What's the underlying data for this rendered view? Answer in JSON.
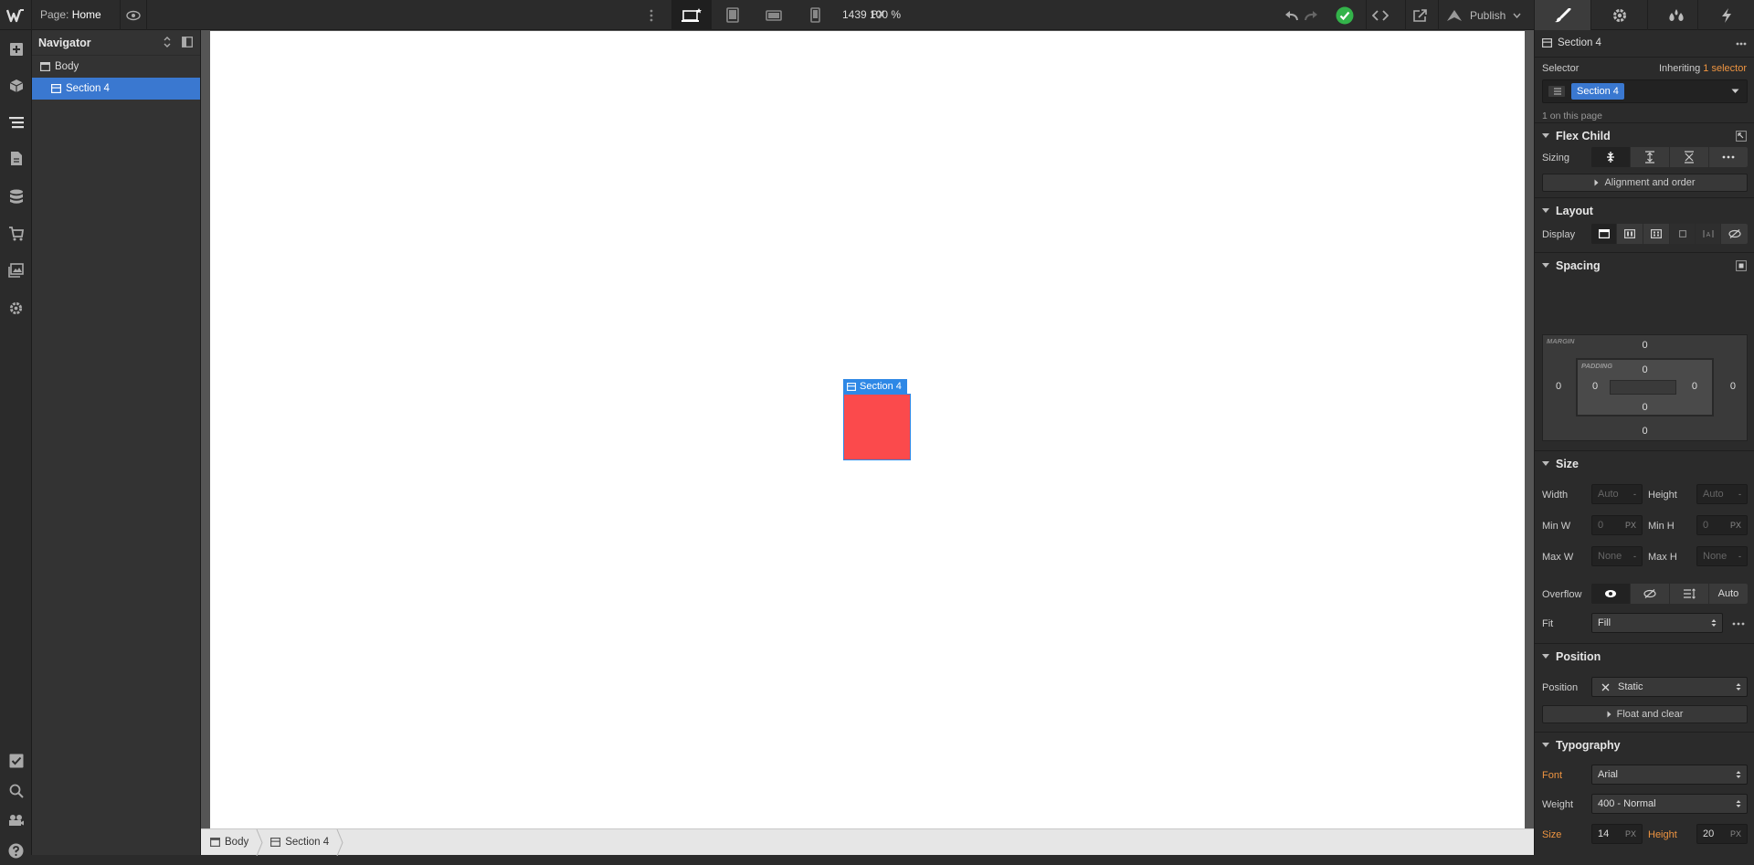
{
  "topbar": {
    "page_key": "Page:",
    "page_name": "Home",
    "canvas_width": "1439",
    "canvas_unit": "PX",
    "zoom": "100 %",
    "publish_label": "Publish",
    "icons": [
      "webflow-logo-icon",
      "eye-icon",
      "kebab-icon",
      "desktop-icon",
      "tablet-icon",
      "mobile-landscape-icon",
      "mobile-portrait-icon",
      "undo-icon",
      "redo-icon",
      "saved-check-icon",
      "code-icon",
      "export-icon",
      "publish-icon",
      "style-brush-icon",
      "settings-gear-icon",
      "interactions-drops-icon",
      "lightning-icon"
    ]
  },
  "navigator": {
    "title": "Navigator",
    "items": [
      {
        "label": "Body"
      },
      {
        "label": "Section 4",
        "selected": true
      }
    ]
  },
  "canvas": {
    "selected_label": "Section 4",
    "box_color": "#fb4a4c",
    "breadcrumb": [
      "Body",
      "Section 4"
    ]
  },
  "panel": {
    "element_name": "Section 4",
    "selector": {
      "label": "Selector",
      "inheriting_text": "Inheriting",
      "inheriting_link": "1 selector",
      "chip": "Section 4",
      "count": "1 on this page"
    },
    "flex_child": {
      "title": "Flex Child",
      "sizing_label": "Sizing",
      "alignment_button": "Alignment and order"
    },
    "layout": {
      "title": "Layout",
      "display_label": "Display"
    },
    "spacing": {
      "title": "Spacing",
      "margin_label": "MARGIN",
      "padding_label": "PADDING",
      "margin": {
        "top": "0",
        "right": "0",
        "bottom": "0",
        "left": "0"
      },
      "padding": {
        "top": "0",
        "right": "0",
        "bottom": "0",
        "left": "0"
      }
    },
    "size": {
      "title": "Size",
      "width_label": "Width",
      "width_value": "Auto",
      "width_unit": "-",
      "height_label": "Height",
      "height_value": "Auto",
      "height_unit": "-",
      "minw_label": "Min W",
      "minw_value": "0",
      "minw_unit": "PX",
      "minh_label": "Min H",
      "minh_value": "0",
      "minh_unit": "PX",
      "maxw_label": "Max W",
      "maxw_value": "None",
      "maxw_unit": "-",
      "maxh_label": "Max H",
      "maxh_value": "None",
      "maxh_unit": "-",
      "overflow_label": "Overflow",
      "overflow_auto": "Auto",
      "fit_label": "Fit",
      "fit_value": "Fill"
    },
    "position": {
      "title": "Position",
      "position_label": "Position",
      "position_value": "Static",
      "float_button": "Float and clear"
    },
    "typography": {
      "title": "Typography",
      "font_label": "Font",
      "font_value": "Arial",
      "weight_label": "Weight",
      "weight_value": "400 - Normal",
      "size_label": "Size",
      "size_value": "14",
      "size_unit": "PX",
      "height_label": "Height",
      "height_value": "20",
      "height_unit": "PX"
    }
  }
}
